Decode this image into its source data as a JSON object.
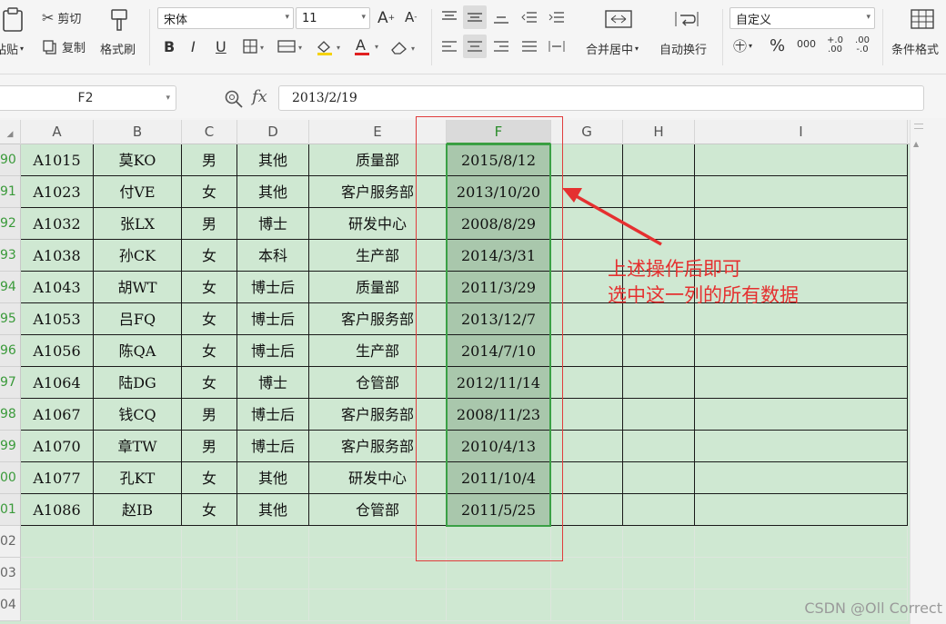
{
  "ribbon": {
    "paste_label": "粘贴",
    "cut_label": "剪切",
    "copy_label": "复制",
    "format_painter_label": "格式刷",
    "font_name": "宋体",
    "font_size": "11",
    "merge_center_label": "合并居中",
    "wrap_text_label": "自动换行",
    "number_format": "自定义",
    "conditional_format_label": "条件格式",
    "bold_glyph": "B",
    "italic_glyph": "I",
    "underline_glyph": "U",
    "percent_glyph": "%",
    "thousands_glyph": "000",
    "inc_decimal_glyph": "+.0 .00",
    "dec_decimal_glyph": ".00 -.0"
  },
  "formula_bar": {
    "name_box": "F2",
    "fx_label": "fx",
    "formula_value": "2013/2/19"
  },
  "columns": [
    "A",
    "B",
    "C",
    "D",
    "E",
    "F",
    "G",
    "H",
    "I"
  ],
  "rows": [
    {
      "num": "90",
      "cells": [
        "A1015",
        "莫KO",
        "男",
        "其他",
        "质量部",
        "2015/8/12"
      ]
    },
    {
      "num": "91",
      "cells": [
        "A1023",
        "付VE",
        "女",
        "其他",
        "客户服务部",
        "2013/10/20"
      ]
    },
    {
      "num": "92",
      "cells": [
        "A1032",
        "张LX",
        "男",
        "博士",
        "研发中心",
        "2008/8/29"
      ]
    },
    {
      "num": "93",
      "cells": [
        "A1038",
        "孙CK",
        "女",
        "本科",
        "生产部",
        "2014/3/31"
      ]
    },
    {
      "num": "94",
      "cells": [
        "A1043",
        "胡WT",
        "女",
        "博士后",
        "质量部",
        "2011/3/29"
      ]
    },
    {
      "num": "95",
      "cells": [
        "A1053",
        "吕FQ",
        "女",
        "博士后",
        "客户服务部",
        "2013/12/7"
      ]
    },
    {
      "num": "96",
      "cells": [
        "A1056",
        "陈QA",
        "女",
        "博士后",
        "生产部",
        "2014/7/10"
      ]
    },
    {
      "num": "97",
      "cells": [
        "A1064",
        "陆DG",
        "女",
        "博士",
        "仓管部",
        "2012/11/14"
      ]
    },
    {
      "num": "98",
      "cells": [
        "A1067",
        "钱CQ",
        "男",
        "博士后",
        "客户服务部",
        "2008/11/23"
      ]
    },
    {
      "num": "99",
      "cells": [
        "A1070",
        "章TW",
        "男",
        "博士后",
        "客户服务部",
        "2010/4/13"
      ]
    },
    {
      "num": "00",
      "cells": [
        "A1077",
        "孔KT",
        "女",
        "其他",
        "研发中心",
        "2011/10/4"
      ]
    },
    {
      "num": "01",
      "cells": [
        "A1086",
        "赵IB",
        "女",
        "其他",
        "仓管部",
        "2011/5/25"
      ]
    }
  ],
  "empty_rows": [
    "02",
    "03",
    "04"
  ],
  "annotation": {
    "line1": "上述操作后即可",
    "line2": "选中这一列的所有数据"
  },
  "watermark": "CSDN @Oll Correct",
  "colors": {
    "selection": "#3aa045",
    "annotation": "#e53030",
    "cell_fill": "#cfe8d2"
  }
}
